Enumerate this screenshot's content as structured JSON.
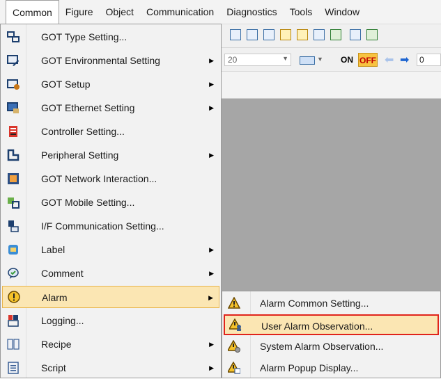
{
  "menubar": {
    "items": [
      {
        "label": "Common"
      },
      {
        "label": "Figure"
      },
      {
        "label": "Object"
      },
      {
        "label": "Communication"
      },
      {
        "label": "Diagnostics"
      },
      {
        "label": "Tools"
      },
      {
        "label": "Window"
      }
    ]
  },
  "toolbar": {
    "zoom_value": "20",
    "on_label": "ON",
    "off_label": "OFF",
    "numeric_value": "0"
  },
  "common_menu": {
    "items": [
      {
        "label": "GOT Type Setting...",
        "icon": "got-type-icon",
        "submenu": false
      },
      {
        "label": "GOT Environmental Setting",
        "icon": "got-environment-icon",
        "submenu": true
      },
      {
        "label": "GOT Setup",
        "icon": "got-setup-icon",
        "submenu": true
      },
      {
        "label": "GOT Ethernet Setting",
        "icon": "got-ethernet-icon",
        "submenu": true
      },
      {
        "label": "Controller Setting...",
        "icon": "controller-icon",
        "submenu": false
      },
      {
        "label": "Peripheral Setting",
        "icon": "peripheral-icon",
        "submenu": true
      },
      {
        "label": "GOT Network Interaction...",
        "icon": "network-interaction-icon",
        "submenu": false
      },
      {
        "label": "GOT Mobile Setting...",
        "icon": "mobile-icon",
        "submenu": false
      },
      {
        "label": "I/F Communication Setting...",
        "icon": "if-communication-icon",
        "submenu": false
      },
      {
        "label": "Label",
        "icon": "label-icon",
        "submenu": true
      },
      {
        "label": "Comment",
        "icon": "comment-icon",
        "submenu": true
      },
      {
        "label": "Alarm",
        "icon": "alarm-icon",
        "submenu": true
      },
      {
        "label": "Logging...",
        "icon": "logging-icon",
        "submenu": false
      },
      {
        "label": "Recipe",
        "icon": "recipe-icon",
        "submenu": true
      },
      {
        "label": "Script",
        "icon": "script-icon",
        "submenu": true
      }
    ],
    "submenu_arrow": "▶"
  },
  "alarm_submenu": {
    "items": [
      {
        "label": "Alarm Common Setting..."
      },
      {
        "label": "User Alarm Observation..."
      },
      {
        "label": "System Alarm Observation..."
      },
      {
        "label": "Alarm Popup Display..."
      }
    ]
  },
  "colors": {
    "highlight": "#fbe6b3",
    "highlight_border": "#e8b44a",
    "selection_frame": "#e0241b"
  }
}
